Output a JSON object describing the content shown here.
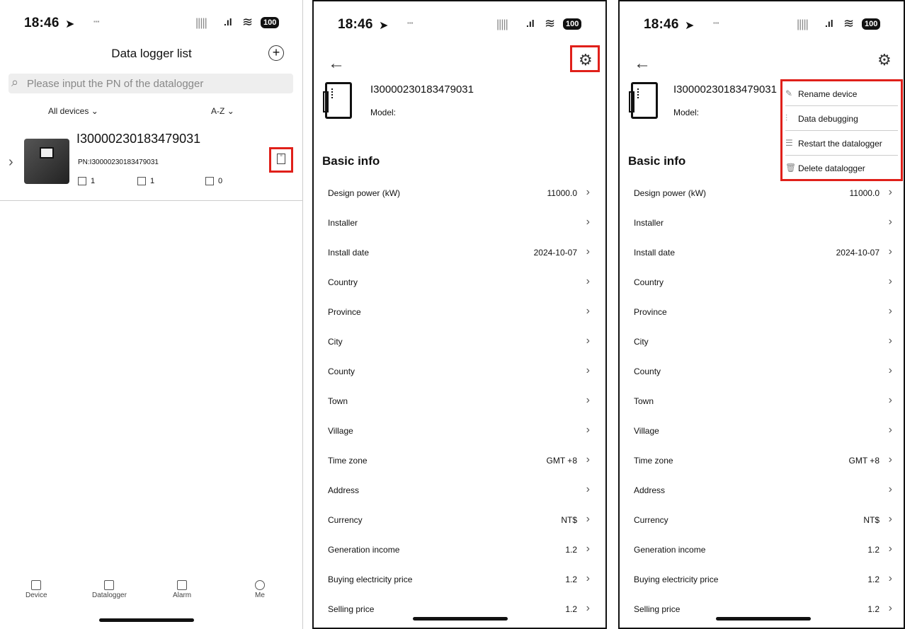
{
  "status": {
    "time": "18:46",
    "battery": "100"
  },
  "list_screen": {
    "title": "Data logger list",
    "search_placeholder": "Please input the PN of the datalogger",
    "filter_devices": "All devices",
    "filter_sort": "A-Z",
    "device": {
      "name": "I30000230183479031",
      "pn": "PN:I30000230183479031",
      "stats": [
        "1",
        "1",
        "0"
      ]
    },
    "tabs": [
      "Device",
      "Datalogger",
      "Alarm",
      "Me"
    ]
  },
  "detail_screen": {
    "serial": "I30000230183479031",
    "model_label": "Model:",
    "section_title": "Basic info",
    "rows": [
      {
        "label": "Design power (kW)",
        "value": "11000.0"
      },
      {
        "label": "Installer",
        "value": ""
      },
      {
        "label": "Install date",
        "value": "2024-10-07"
      },
      {
        "label": "Country",
        "value": ""
      },
      {
        "label": "Province",
        "value": ""
      },
      {
        "label": "City",
        "value": ""
      },
      {
        "label": "County",
        "value": ""
      },
      {
        "label": "Town",
        "value": ""
      },
      {
        "label": "Village",
        "value": ""
      },
      {
        "label": "Time zone",
        "value": "GMT +8"
      },
      {
        "label": "Address",
        "value": ""
      },
      {
        "label": "Currency",
        "value": "NT$"
      },
      {
        "label": "Generation income",
        "value": "1.2"
      },
      {
        "label": "Buying electricity price",
        "value": "1.2"
      },
      {
        "label": "Selling price",
        "value": "1.2"
      }
    ]
  },
  "menu_screen": {
    "serial_truncated": "I30000230183479031",
    "menu": [
      "Rename device",
      "Data debugging",
      "Restart the datalogger",
      "Delete datalogger"
    ]
  },
  "colors": {
    "highlight": "#e0201a"
  }
}
